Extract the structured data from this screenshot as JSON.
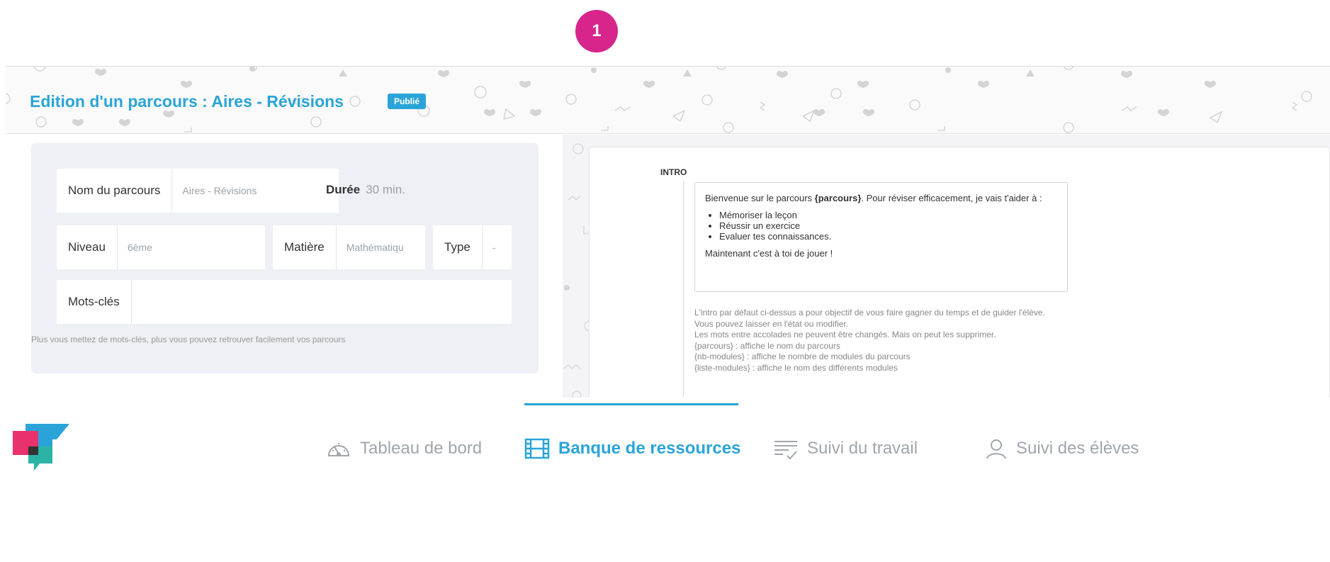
{
  "step_badge": "1",
  "header": {
    "title": "Edition d'un parcours : Aires - Révisions",
    "status": "Publié"
  },
  "form": {
    "name_label": "Nom du parcours",
    "name_value": "Aires - Révisions",
    "duration_label": "Durée",
    "duration_value": "30 min.",
    "level_label": "Niveau",
    "level_value": "6ème",
    "subject_label": "Matière",
    "subject_value": "Mathématiqu",
    "type_label": "Type",
    "type_value": "-",
    "keywords_label": "Mots-clés",
    "keywords_value": "",
    "hint": "Plus vous mettez de mots-clés, plus vous pouvez retrouver facilement vos parcours"
  },
  "intro": {
    "heading": "INTRO",
    "text_before": "Bienvenue sur le parcours ",
    "text_bold": "{parcours}",
    "text_after": ". Pour réviser efficacement, je vais t'aider à :",
    "bullets": [
      "Mémoriser la leçon",
      "Réussir un exercice",
      "Evaluer tes connaissances."
    ],
    "closing": "Maintenant c'est à toi de jouer !",
    "help": [
      "L'intro par défaut ci-dessus a pour objectif de vous faire gagner du temps et de guider l'élève.",
      "Vous pouvez laisser en l'état ou modifier.",
      "Les mots entre accolades ne peuvent être changés. Mais on peut les supprimer.",
      "{parcours} : affiche le nom du parcours",
      "{nb-modules} : affiche le nombre de modules du parcours",
      "{liste-modules} : affiche le nom des différents modules"
    ]
  },
  "nav": {
    "items": [
      {
        "label": "Tableau de bord",
        "icon": "gauge-icon"
      },
      {
        "label": "Banque de ressources",
        "icon": "film-icon"
      },
      {
        "label": "Suivi du travail",
        "icon": "list-check-icon"
      },
      {
        "label": "Suivi des élèves",
        "icon": "user-icon"
      }
    ]
  },
  "colors": {
    "accent": "#2aa4d8",
    "badge": "#d7258c",
    "panel": "#eef0f5"
  }
}
